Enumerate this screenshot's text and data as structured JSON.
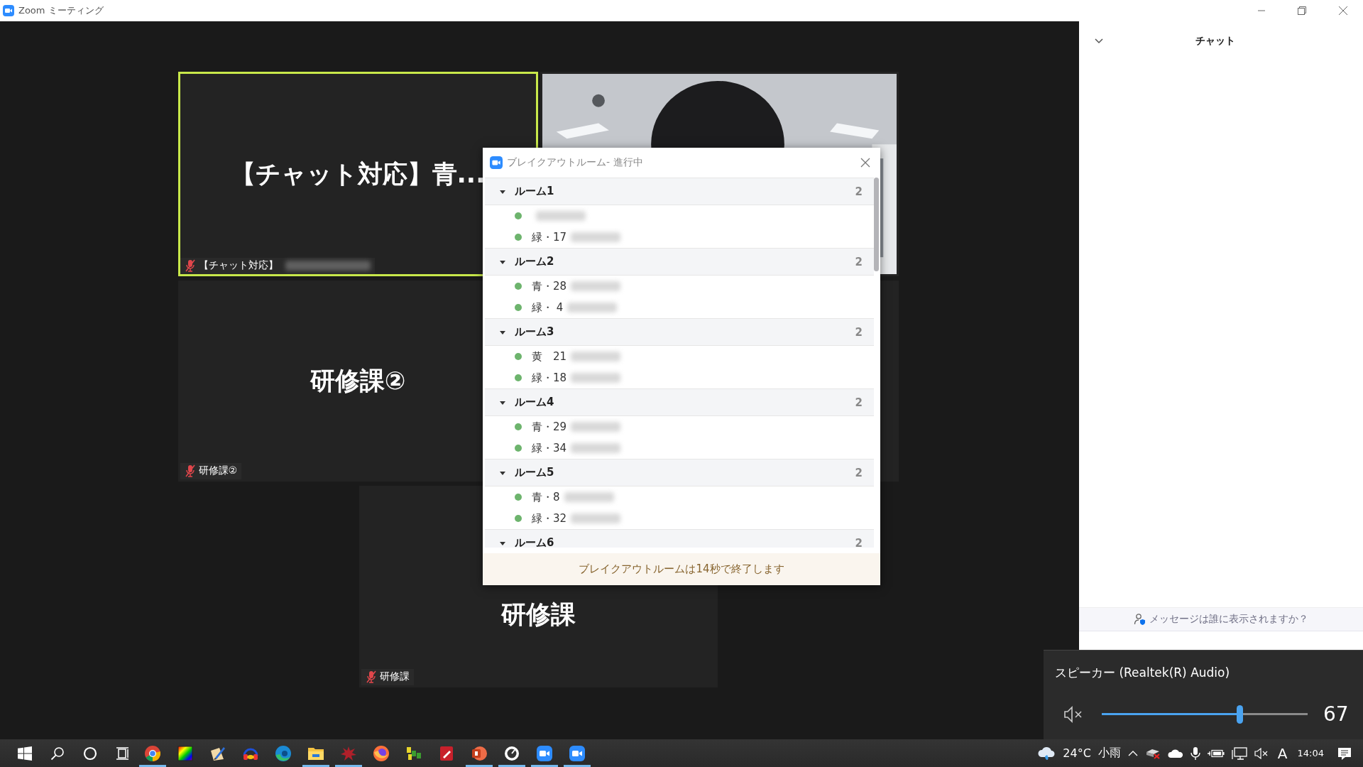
{
  "window": {
    "title": "Zoom ミーティング"
  },
  "gallery": {
    "tiles": [
      {
        "kind": "name",
        "display_name": "【チャット対応】青...",
        "label": "【チャット対応】",
        "label_redacted": true,
        "muted": true,
        "active": true
      },
      {
        "kind": "video",
        "active": false
      },
      {
        "kind": "name",
        "display_name": "研修課②",
        "label": "研修課②",
        "label_redacted": false,
        "muted": true,
        "active": false
      },
      {
        "kind": "blank",
        "active": false
      },
      {
        "kind": "name",
        "display_name": "研修課",
        "label": "研修課",
        "label_redacted": false,
        "muted": true,
        "active": false
      }
    ]
  },
  "breakout_dialog": {
    "title": "ブレイクアウトルーム- 進行中",
    "rooms": [
      {
        "name": "ルーム1",
        "count": "2",
        "expanded": true,
        "members": [
          {
            "redacted": true
          },
          {
            "label": "緑・17",
            "redacted": true
          }
        ]
      },
      {
        "name": "ルーム2",
        "count": "2",
        "expanded": true,
        "members": [
          {
            "label": "青・28",
            "redacted": true
          },
          {
            "label": "緑・ 4",
            "redacted": true
          }
        ]
      },
      {
        "name": "ルーム3",
        "count": "2",
        "expanded": true,
        "members": [
          {
            "label": "黄　21",
            "redacted": true
          },
          {
            "label": "緑・18",
            "redacted": true
          }
        ]
      },
      {
        "name": "ルーム4",
        "count": "2",
        "expanded": true,
        "members": [
          {
            "label": "青・29",
            "redacted": true
          },
          {
            "label": "緑・34",
            "redacted": true
          }
        ]
      },
      {
        "name": "ルーム5",
        "count": "2",
        "expanded": true,
        "members": [
          {
            "label": "青・8",
            "redacted": true
          },
          {
            "label": "緑・32",
            "redacted": true
          }
        ]
      },
      {
        "name": "ルーム6",
        "count": "2",
        "expanded": true
      }
    ],
    "notice": "ブレイクアウトルームは14秒で終了します"
  },
  "chat_panel": {
    "title": "チャット",
    "visibility_hint": "メッセージは誰に表示されますか？"
  },
  "volume_flyout": {
    "device": "スピーカー (Realtek(R) Audio)",
    "muted": true,
    "level": 0.67,
    "reading": "67"
  },
  "taskbar": {
    "apps": [
      {
        "kind": "browser",
        "running": true
      },
      {
        "kind": "palette",
        "running": false
      },
      {
        "kind": "paint",
        "running": false
      },
      {
        "kind": "headset",
        "running": false
      },
      {
        "kind": "edge",
        "running": false
      },
      {
        "kind": "folder",
        "running": true
      },
      {
        "kind": "splat",
        "running": true
      },
      {
        "kind": "fox",
        "running": false
      },
      {
        "kind": "ftp",
        "running": false
      },
      {
        "kind": "pdf",
        "running": false
      },
      {
        "kind": "slides",
        "running": true
      },
      {
        "kind": "dial",
        "running": true
      },
      {
        "kind": "video",
        "running": true
      },
      {
        "kind": "video",
        "running": true
      }
    ],
    "temperature": "24°C",
    "condition": "小雨",
    "ime": "A",
    "clock": "14:04",
    "volume_muted": true
  }
}
